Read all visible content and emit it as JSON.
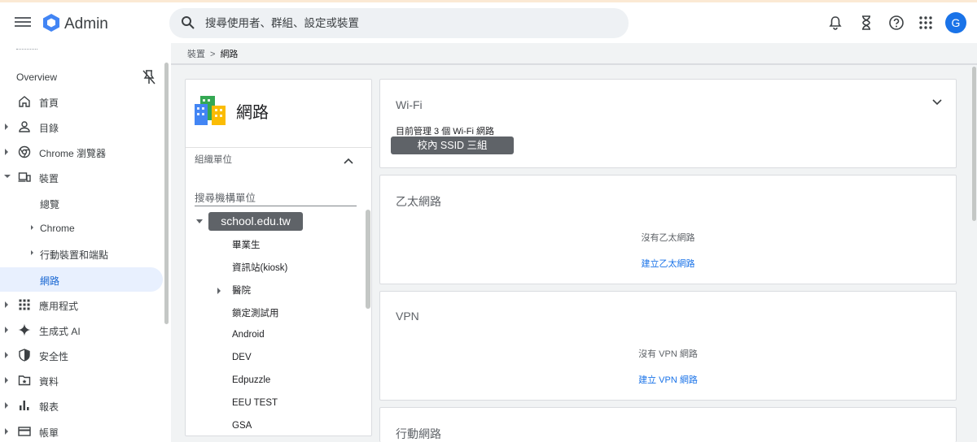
{
  "topbar": {
    "brand": "Admin",
    "search_placeholder": "搜尋使用者、群組、設定或裝置",
    "avatar_letter": "G"
  },
  "sidebar": {
    "overview": "Overview",
    "items": [
      {
        "label": "首頁",
        "icon": "home-icon"
      },
      {
        "label": "目錄",
        "icon": "person-icon"
      },
      {
        "label": "Chrome 瀏覽器",
        "icon": "chrome-icon"
      },
      {
        "label": "裝置",
        "icon": "devices-icon"
      },
      {
        "label": "總覽"
      },
      {
        "label": "Chrome"
      },
      {
        "label": "行動裝置和端點"
      },
      {
        "label": "網路"
      },
      {
        "label": "應用程式",
        "icon": "apps-grid-icon"
      },
      {
        "label": "生成式 AI",
        "icon": "sparkle-icon"
      },
      {
        "label": "安全性",
        "icon": "shield-icon"
      },
      {
        "label": "資料",
        "icon": "data-folder-icon"
      },
      {
        "label": "報表",
        "icon": "bar-chart-icon"
      },
      {
        "label": "帳單",
        "icon": "credit-card-icon"
      }
    ],
    "active_label": "網路"
  },
  "breadcrumb": {
    "parent": "裝置",
    "separator": ">",
    "current": "網路"
  },
  "left_panel": {
    "title": "網路",
    "ou_label": "組織單位",
    "ou_search_placeholder": "搜尋機構單位",
    "root": "school.edu.tw",
    "children": [
      "畢業生",
      "資訊站(kiosk)",
      "醫院",
      "鎖定測試用",
      "Android",
      "DEV",
      "Edpuzzle",
      "EEU TEST",
      "GSA"
    ]
  },
  "cards": {
    "wifi": {
      "title": "Wi-Fi",
      "description": "目前管理 3 個 Wi-Fi 網路",
      "ssid_chip": "校內 SSID 三組"
    },
    "ethernet": {
      "title": "乙太網路",
      "empty": "沒有乙太網路",
      "link": "建立乙太網路"
    },
    "vpn": {
      "title": "VPN",
      "empty": "沒有 VPN 網路",
      "link": "建立 VPN 網路"
    },
    "mobile": {
      "title": "行動網路"
    }
  },
  "colors": {
    "accent": "#1a73e8",
    "active_bg": "#e8f0fe",
    "chip_bg": "#5f6368"
  }
}
